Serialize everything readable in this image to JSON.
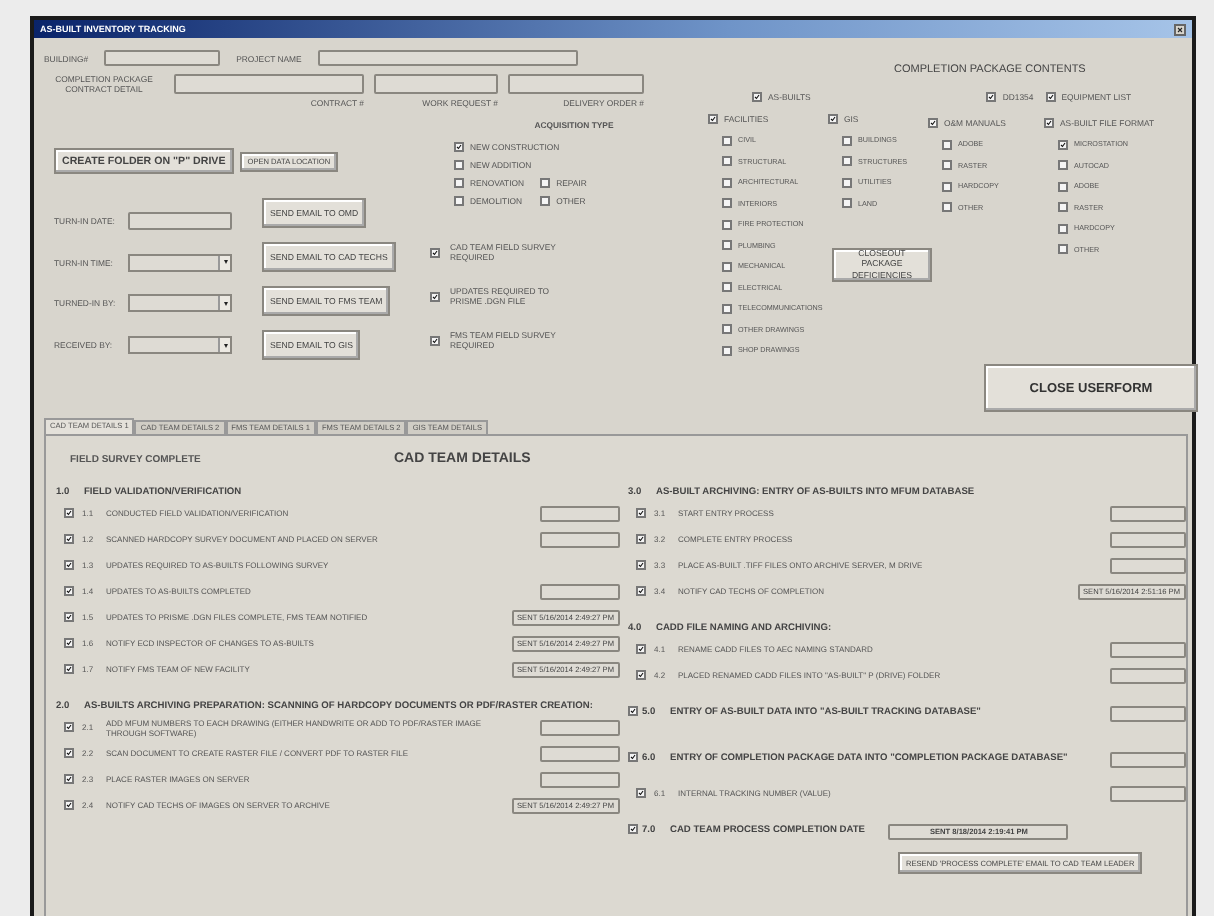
{
  "window": {
    "title": "AS-BUILT INVENTORY TRACKING"
  },
  "header": {
    "fields": [
      {
        "label": "BUILDING#"
      },
      {
        "label": "PROJECT NAME"
      }
    ],
    "package_label": "COMPLETION PACKAGE CONTRACT DETAIL",
    "package_fields": [
      {
        "label": "CONTRACT #"
      },
      {
        "label": "WORK REQUEST #"
      },
      {
        "label": "DELIVERY ORDER #"
      }
    ]
  },
  "folder_buttons": [
    "CREATE FOLDER ON \"P\" DRIVE",
    "OPEN DATA LOCATION"
  ],
  "turn_in": [
    {
      "label": "TURN-IN DATE:",
      "kind": "text"
    },
    {
      "label": "TURN-IN TIME:",
      "kind": "combo"
    },
    {
      "label": "TURNED-IN BY:",
      "kind": "combo"
    },
    {
      "label": "RECEIVED BY:",
      "kind": "combo"
    }
  ],
  "email_buttons": [
    "SEND EMAIL TO OMD",
    "SEND EMAIL TO CAD TECHS",
    "SEND EMAIL TO FMS TEAM",
    "SEND EMAIL TO GIS"
  ],
  "acquisition": {
    "title": "ACQUISITION TYPE",
    "options": [
      {
        "label": "NEW CONSTRUCTION",
        "checked": true
      },
      {
        "label": "NEW ADDITION",
        "checked": false
      },
      {
        "label": "RENOVATION",
        "checked": false
      },
      {
        "label": "REPAIR",
        "checked": false
      },
      {
        "label": "DEMOLITION",
        "checked": false
      },
      {
        "label": "OTHER",
        "checked": false
      }
    ]
  },
  "flags": [
    {
      "label": "CAD TEAM FIELD SURVEY REQUIRED",
      "checked": true
    },
    {
      "label": "UPDATES REQUIRED TO PRISME .DGN FILE",
      "checked": true
    },
    {
      "label": "FMS TEAM FIELD SURVEY REQUIRED",
      "checked": true
    }
  ],
  "contents": {
    "title": "COMPLETION PACKAGE CONTENTS",
    "top": [
      {
        "label": "AS-BUILTS",
        "checked": true
      },
      {
        "label": "DD1354",
        "checked": true
      },
      {
        "label": "EQUIPMENT LIST",
        "checked": true
      }
    ],
    "groups": [
      {
        "label": "FACILITIES",
        "checked": true,
        "items": [
          {
            "label": "CIVIL",
            "checked": false
          },
          {
            "label": "STRUCTURAL",
            "checked": false
          },
          {
            "label": "ARCHITECTURAL",
            "checked": false
          },
          {
            "label": "INTERIORS",
            "checked": false
          },
          {
            "label": "FIRE PROTECTION",
            "checked": false
          },
          {
            "label": "PLUMBING",
            "checked": false
          },
          {
            "label": "MECHANICAL",
            "checked": false
          },
          {
            "label": "ELECTRICAL",
            "checked": false
          },
          {
            "label": "TELECOMMUNICATIONS",
            "checked": false
          },
          {
            "label": "OTHER DRAWINGS",
            "checked": false
          },
          {
            "label": "SHOP DRAWINGS",
            "checked": false
          }
        ]
      },
      {
        "label": "GIS",
        "checked": true,
        "items": [
          {
            "label": "BUILDINGS",
            "checked": false
          },
          {
            "label": "STRUCTURES",
            "checked": false
          },
          {
            "label": "UTILITIES",
            "checked": false
          },
          {
            "label": "LAND",
            "checked": false
          }
        ]
      },
      {
        "label": "O&M MANUALS",
        "checked": true,
        "items": [
          {
            "label": "ADOBE",
            "checked": false
          },
          {
            "label": "RASTER",
            "checked": false
          },
          {
            "label": "HARDCOPY",
            "checked": false
          },
          {
            "label": "OTHER",
            "checked": false
          }
        ]
      },
      {
        "label": "AS-BUILT FILE FORMAT",
        "checked": true,
        "items": [
          {
            "label": "MICROSTATION",
            "checked": true
          },
          {
            "label": "AUTOCAD",
            "checked": false
          },
          {
            "label": "ADOBE",
            "checked": false
          },
          {
            "label": "RASTER",
            "checked": false
          },
          {
            "label": "HARDCOPY",
            "checked": false
          },
          {
            "label": "OTHER",
            "checked": false
          }
        ]
      }
    ],
    "closeout_button": "CLOSEOUT PACKAGE DEFICIENCIES",
    "close_button": "CLOSE USERFORM"
  },
  "tabs": [
    {
      "label": "CAD TEAM DETAILS 1",
      "selected": true
    },
    {
      "label": "CAD TEAM DETAILS 2",
      "selected": false
    },
    {
      "label": "FMS TEAM DETAILS 1",
      "selected": false
    },
    {
      "label": "FMS TEAM DETAILS 2",
      "selected": false
    },
    {
      "label": "GIS TEAM DETAILS",
      "selected": false
    }
  ],
  "panel": {
    "left_title": "FIELD SURVEY COMPLETE",
    "title": "CAD TEAM DETAILS",
    "columns": [
      [
        {
          "kind": "heading",
          "number": "1.0",
          "title": "FIELD VALIDATION/VERIFICATION",
          "steps": [
            {
              "number": "1.1",
              "label": "CONDUCTED FIELD VALIDATION/VERIFICATION",
              "checked": true,
              "field": true
            },
            {
              "number": "1.2",
              "label": "SCANNED HARDCOPY SURVEY DOCUMENT AND PLACED ON SERVER",
              "checked": true,
              "field": true
            },
            {
              "number": "1.3",
              "label": "UPDATES REQUIRED TO AS-BUILTS FOLLOWING SURVEY",
              "checked": true,
              "field": false
            },
            {
              "number": "1.4",
              "label": "UPDATES TO AS-BUILTS COMPLETED",
              "checked": true,
              "field": true
            },
            {
              "number": "1.5",
              "label": "UPDATES TO PRISME .DGN FILES COMPLETE, FMS TEAM NOTIFIED",
              "checked": true,
              "field": true,
              "value": "SENT 5/16/2014 2:49:27 PM"
            },
            {
              "number": "1.6",
              "label": "NOTIFY ECD INSPECTOR OF CHANGES TO AS-BUILTS",
              "checked": true,
              "field": true,
              "value": "SENT 5/16/2014 2:49:27 PM"
            },
            {
              "number": "1.7",
              "label": "NOTIFY FMS TEAM OF NEW FACILITY",
              "checked": true,
              "field": true,
              "value": "SENT 5/16/2014 2:49:27 PM"
            }
          ]
        },
        {
          "kind": "heading",
          "number": "2.0",
          "title": "AS-BUILTS ARCHIVING PREPARATION: SCANNING OF HARDCOPY DOCUMENTS OR PDF/RASTER CREATION:",
          "steps": [
            {
              "number": "2.1",
              "label": "ADD MFUM NUMBERS TO EACH DRAWING (EITHER HANDWRITE OR ADD TO PDF/RASTER IMAGE THROUGH SOFTWARE)",
              "checked": true,
              "field": true
            },
            {
              "number": "2.2",
              "label": "SCAN DOCUMENT TO CREATE RASTER FILE / CONVERT PDF TO RASTER FILE",
              "checked": true,
              "field": true
            },
            {
              "number": "2.3",
              "label": "PLACE RASTER IMAGES ON SERVER",
              "checked": true,
              "field": true
            },
            {
              "number": "2.4",
              "label": "NOTIFY CAD TECHS OF IMAGES ON SERVER TO ARCHIVE",
              "checked": true,
              "field": true,
              "value": "SENT 5/16/2014 2:49:27 PM"
            }
          ]
        }
      ],
      [
        {
          "kind": "heading",
          "number": "3.0",
          "title": "AS-BUILT ARCHIVING: ENTRY OF AS-BUILTS INTO MFUM DATABASE",
          "steps": [
            {
              "number": "3.1",
              "label": "START ENTRY PROCESS",
              "checked": true,
              "field": true
            },
            {
              "number": "3.2",
              "label": "COMPLETE ENTRY PROCESS",
              "checked": true,
              "field": true
            },
            {
              "number": "3.3",
              "label": "PLACE AS-BUILT .TIFF FILES ONTO ARCHIVE SERVER, M DRIVE",
              "checked": true,
              "field": true
            },
            {
              "number": "3.4",
              "label": "NOTIFY CAD TECHS OF COMPLETION",
              "checked": true,
              "field": true,
              "value": "SENT 5/16/2014 2:51:16 PM"
            }
          ]
        },
        {
          "kind": "heading",
          "number": "4.0",
          "title": "CADD FILE NAMING AND ARCHIVING:",
          "steps": [
            {
              "number": "4.1",
              "label": "RENAME CADD FILES TO AEC NAMING STANDARD",
              "checked": true,
              "field": true
            },
            {
              "number": "4.2",
              "label": "PLACED RENAMED CADD FILES INTO \"AS-BUILT\" P (DRIVE) FOLDER",
              "checked": true,
              "field": true
            }
          ]
        },
        {
          "kind": "check",
          "number": "5.0",
          "title": "ENTRY OF AS-BUILT DATA INTO \"AS-BUILT TRACKING DATABASE\"",
          "checked": true,
          "field": true
        },
        {
          "kind": "check",
          "number": "6.0",
          "title": "ENTRY OF COMPLETION PACKAGE DATA INTO \"COMPLETION PACKAGE DATABASE\"",
          "checked": true,
          "field": true,
          "steps": [
            {
              "number": "6.1",
              "label": "INTERNAL TRACKING NUMBER (VALUE)",
              "checked": true,
              "field": true
            }
          ]
        },
        {
          "kind": "check",
          "number": "7.0",
          "title": "CAD TEAM PROCESS COMPLETION DATE",
          "checked": true,
          "field": true,
          "value": "SENT 8/18/2014 2:19:41 PM",
          "button": "RESEND 'PROCESS COMPLETE' EMAIL TO CAD TEAM LEADER"
        }
      ]
    ]
  }
}
